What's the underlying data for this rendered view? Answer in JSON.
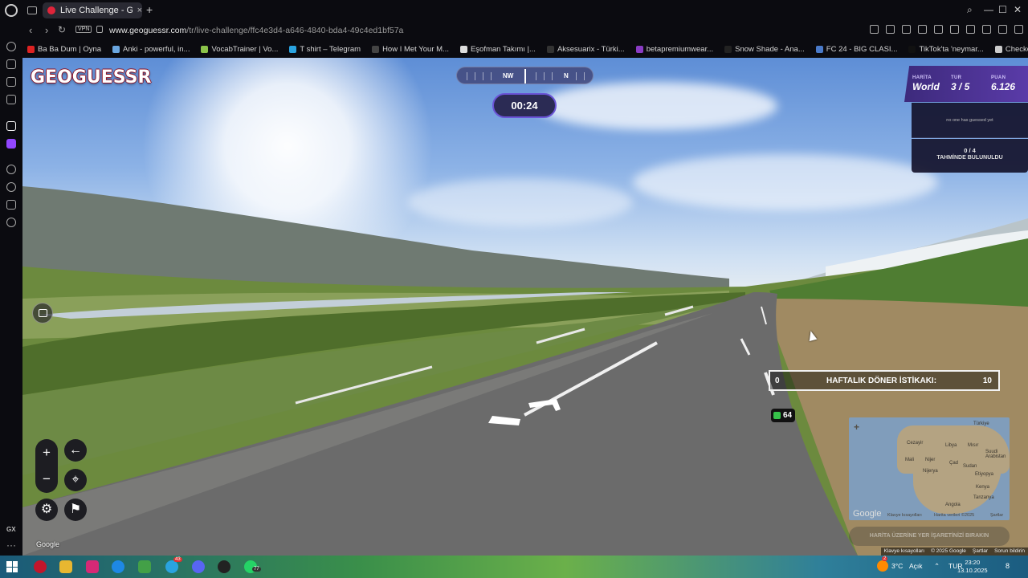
{
  "browser": {
    "tab_title": "Live Challenge - GeoGues",
    "new_tab": "+",
    "url_host": "www.geoguessr.com",
    "url_path": "/tr/live-challenge/ffc4e3d4-a646-4840-bda4-49c4ed1bf57a",
    "vpn_label": "VPN",
    "bookmarks": [
      {
        "label": "Ba Ba Dum | Oyna",
        "color": "#d22"
      },
      {
        "label": "Anki - powerful, in...",
        "color": "#6aa6e0"
      },
      {
        "label": "VocabTrainer | Vo...",
        "color": "#8bc34a"
      },
      {
        "label": "T shirt – Telegram",
        "color": "#2aa3e0"
      },
      {
        "label": "How I Met Your M...",
        "color": "#444"
      },
      {
        "label": "Eşofman Takımı |...",
        "color": "#ddd"
      },
      {
        "label": "Aksesuarix - Türki...",
        "color": "#333"
      },
      {
        "label": "betapremiumwear...",
        "color": "#8a3cc4"
      },
      {
        "label": "Snow Shade - Ana...",
        "color": "#222"
      },
      {
        "label": "FC 24 - BIG CLASI...",
        "color": "#4a7ac9"
      },
      {
        "label": "TikTok'ta 'neymar...",
        "color": "#111"
      },
      {
        "label": "Checkout - AimCh...",
        "color": "#ccc"
      }
    ],
    "sidebar_gx": "GX",
    "sidebar_more": "···"
  },
  "game": {
    "logo": "GEOGUESSR",
    "compass": {
      "labels": [
        "NW",
        "N"
      ]
    },
    "timer": "00:24",
    "score_panel": {
      "map_label": "HARİTA",
      "map_value": "World",
      "round_label": "TUR",
      "round_value": "3 / 5",
      "points_label": "PUAN",
      "points_value": "6.126"
    },
    "guess_status": "no one has guessed yet",
    "found_count": "0 / 4",
    "found_label": "TAHMİNDE BULUNULDU",
    "weekly": {
      "left": "0",
      "label": "HAFTALIK DÖNER İSTİKAKI:",
      "right": "10"
    },
    "badge_value": "64",
    "controls": {
      "zoom_in": "+",
      "zoom_out": "−",
      "back": "←"
    },
    "minimap": {
      "zoom": "+",
      "labels": [
        "Türkiye",
        "Libya",
        "Mısır",
        "Cezayir",
        "Suudi Arabistan",
        "Mali",
        "Nijer",
        "Çad",
        "Sudan",
        "Nijerya",
        "Etiyopya",
        "Kenya",
        "Tanzanya",
        "Angola"
      ],
      "google": "Google",
      "keyboard": "Klavye kısayolları",
      "map_data": "Harita verileri ©2025",
      "terms": "Şartlar"
    },
    "guess_button": "HARİTA ÜZERİNE YER İŞARETİNİZİ BIRAKIN"
  },
  "footer": {
    "google_watermark": "Google",
    "attribution": [
      "Klavye kısayolları",
      "© 2025 Google",
      "Şartlar",
      "Sorun bildirin"
    ]
  },
  "taskbar": {
    "badge_a": "43",
    "badge_b": "77",
    "badge_weather": "2",
    "weather": "3°C",
    "weather_desc": "Açık",
    "lang": "TUR",
    "time": "23:20",
    "date": "13.10.2025",
    "notif": "8"
  }
}
